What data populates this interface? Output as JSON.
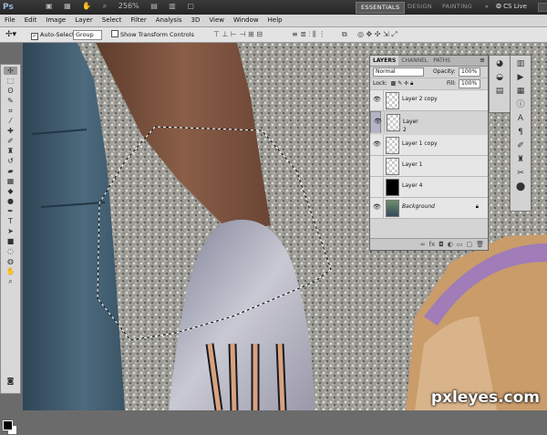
{
  "app": {
    "logo": "Ps",
    "zoom": "256%",
    "workspaces": [
      {
        "label": "ESSENTIALS",
        "active": true
      },
      {
        "label": "DESIGN",
        "active": false
      },
      {
        "label": "PAINTING",
        "active": false
      }
    ],
    "cs_live": "CS Live"
  },
  "menu": [
    "File",
    "Edit",
    "Image",
    "Layer",
    "Select",
    "Filter",
    "Analysis",
    "3D",
    "View",
    "Window",
    "Help"
  ],
  "options": {
    "auto_select_label": "Auto-Select:",
    "auto_select_checked": true,
    "auto_select_value": "Group",
    "transform_label": "Show Transform Controls",
    "transform_checked": false
  },
  "layers_panel": {
    "tabs": [
      "LAYERS",
      "CHANNEL",
      "PATHS"
    ],
    "blend_mode": "Normal",
    "opacity_label": "Opacity:",
    "opacity": "100%",
    "lock_label": "Lock:",
    "fill_label": "Fill:",
    "fill": "100%",
    "layers": [
      {
        "name": "Layer 2 copy",
        "visible": true,
        "selected": false,
        "thumb": "transparent"
      },
      {
        "name": "Layer 2",
        "visible": true,
        "selected": true,
        "thumb": "transparent"
      },
      {
        "name": "Layer 1 copy",
        "visible": true,
        "selected": false,
        "thumb": "transparent"
      },
      {
        "name": "Layer 1",
        "visible": false,
        "selected": false,
        "thumb": "transparent"
      },
      {
        "name": "Layer 4",
        "visible": false,
        "selected": false,
        "thumb": "black"
      },
      {
        "name": "Background",
        "visible": true,
        "selected": false,
        "thumb": "photo",
        "locked": true
      }
    ]
  },
  "colors": {
    "foreground": "#000000",
    "background": "#ffffff",
    "selected_layer": "#b4b4c8"
  },
  "watermark": "pxleyes.com"
}
